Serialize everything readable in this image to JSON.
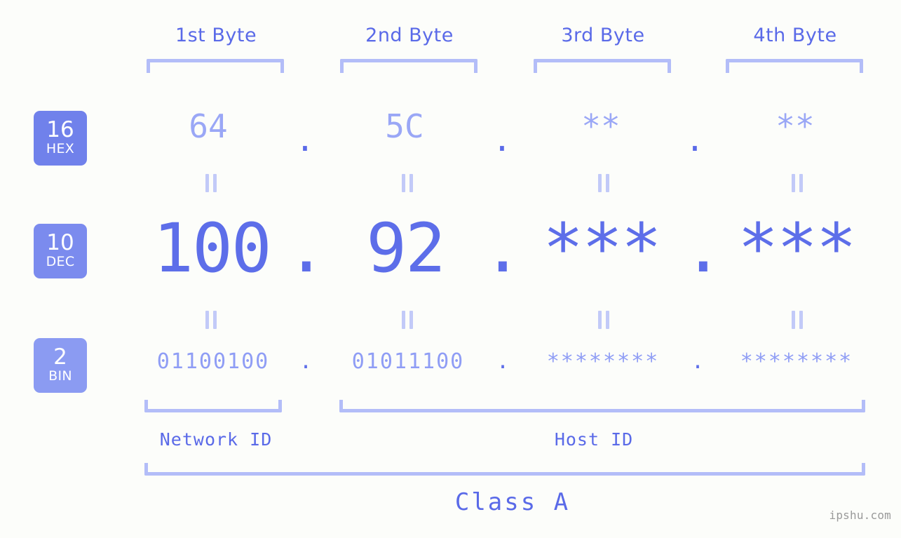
{
  "meta": {
    "background_color": "#fcfdfa",
    "accent_strong": "#5a6ae8",
    "accent_mid": "#8f9df5",
    "accent_light": "#b3bdf8",
    "watermark": "ipshu.com"
  },
  "byte_headers": [
    {
      "label": "1st Byte"
    },
    {
      "label": "2nd Byte"
    },
    {
      "label": "3rd Byte"
    },
    {
      "label": "4th Byte"
    }
  ],
  "radix_badges": [
    {
      "number": "16",
      "name": "HEX",
      "color": "#7081eb"
    },
    {
      "number": "10",
      "name": "DEC",
      "color": "#7b8bee"
    },
    {
      "number": "2",
      "name": "BIN",
      "color": "#8b9bf2"
    }
  ],
  "rows": {
    "hex": {
      "radix_number": "16",
      "radix_name": "HEX",
      "values": [
        "64",
        "5C",
        "**",
        "**"
      ],
      "separators": [
        ".",
        ".",
        "."
      ]
    },
    "dec": {
      "radix_number": "10",
      "radix_name": "DEC",
      "values": [
        "100",
        "92",
        "***",
        "***"
      ],
      "separators": [
        ".",
        ".",
        "."
      ]
    },
    "bin": {
      "radix_number": "2",
      "radix_name": "BIN",
      "values": [
        "01100100",
        "01011100",
        "********",
        "********"
      ],
      "separators": [
        ".",
        ".",
        "."
      ]
    }
  },
  "equals_marks": {
    "symbol": "||",
    "count": 8
  },
  "id_labels": {
    "network": "Network ID",
    "host": "Host ID"
  },
  "class_label": "Class A"
}
